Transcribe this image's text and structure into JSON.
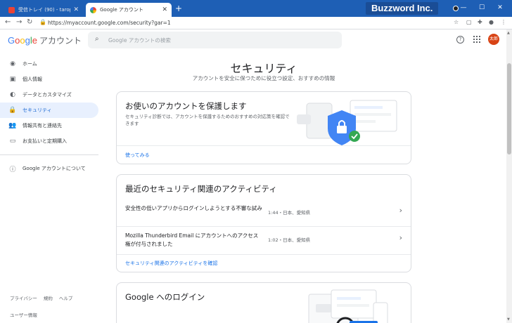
{
  "browser": {
    "tabs": [
      {
        "title": "受信トレイ (90) - taropaper@gm...",
        "active": false
      },
      {
        "title": "Google アカウント",
        "active": true
      }
    ],
    "brand_overlay": "Buzzword Inc.",
    "url": "https://myaccount.google.com/security?gar=1",
    "new_tab": "+"
  },
  "header": {
    "logo": "Google",
    "logo_suffix": "アカウント",
    "search_placeholder": "Google アカウントの検索",
    "help_glyph": "?",
    "avatar_text": "太郎",
    "avatar_color": "#d84315"
  },
  "sidebar": {
    "items": [
      {
        "label": "ホーム",
        "icon": "home-icon",
        "glyph": "◉"
      },
      {
        "label": "個人情報",
        "icon": "person-card-icon",
        "glyph": "▣"
      },
      {
        "label": "データとカスタマイズ",
        "icon": "toggle-icon",
        "glyph": "◐"
      },
      {
        "label": "セキュリティ",
        "icon": "lock-icon",
        "glyph": "🔒",
        "active": true
      },
      {
        "label": "情報共有と連絡先",
        "icon": "people-icon",
        "glyph": "👥"
      },
      {
        "label": "お支払いと定期購入",
        "icon": "credit-card-icon",
        "glyph": "▭"
      }
    ],
    "about": {
      "label": "Google アカウントについて",
      "icon": "info-icon",
      "glyph": "ⓘ"
    },
    "footer_links": [
      "プライバシー",
      "規約",
      "ヘルプ"
    ],
    "footer_user": "ユーザー情報"
  },
  "main": {
    "title": "セキュリティ",
    "subtitle": "アカウントを安全に保つために役立つ設定、おすすめの情報",
    "protect_card": {
      "title": "お使いのアカウントを保護します",
      "body": "セキュリティ診断では、アカウントを保護するためのおすすめの対応策を確認できます",
      "link": "使ってみる"
    },
    "activity_card": {
      "title": "最近のセキュリティ関連のアクティビティ",
      "rows": [
        {
          "text": "安全性の低いアプリからログインしようとする不審な試み",
          "meta": "1:44・日本、愛知県"
        },
        {
          "text": "Mozilla Thunderbird Email にアカウントへのアクセス権が付与されました",
          "meta": "1:02・日本、愛知県"
        }
      ],
      "link": "セキュリティ関連のアクティビティを確認"
    },
    "signin_card": {
      "title": "Google へのログイン"
    }
  },
  "colors": {
    "titlebar": "#1e5fb5",
    "accent_blue": "#1a73e8",
    "active_nav_bg": "#e8f0fe",
    "shield_blue": "#4285f4",
    "check_green": "#34a853"
  }
}
